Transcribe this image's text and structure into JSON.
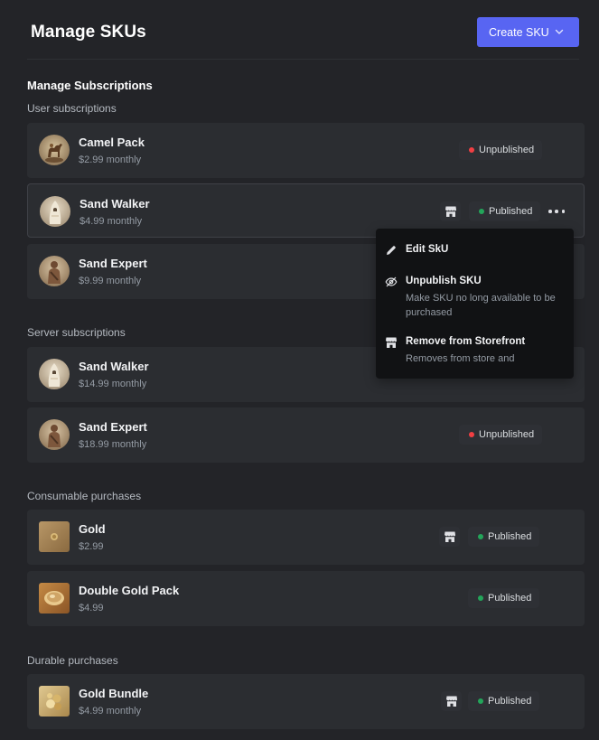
{
  "header": {
    "title": "Manage SKUs",
    "create_label": "Create SKU"
  },
  "section_title": "Manage Subscriptions",
  "groups": {
    "user": "User subscriptions",
    "server": "Server subscriptions",
    "consumable": "Consumable purchases",
    "durable": "Durable purchases"
  },
  "rows": [
    {
      "name": "Camel Pack",
      "price": "$2.99 monthly",
      "status": "Unpublished"
    },
    {
      "name": "Sand Walker",
      "price": "$4.99 monthly",
      "status": "Published"
    },
    {
      "name": "Sand Expert",
      "price": "$9.99 monthly",
      "status": ""
    },
    {
      "name": "Sand Walker",
      "price": "$14.99 monthly",
      "status": ""
    },
    {
      "name": "Sand Expert",
      "price": "$18.99 monthly",
      "status": "Unpublished"
    },
    {
      "name": "Gold",
      "price": "$2.99",
      "status": "Published"
    },
    {
      "name": "Double Gold Pack",
      "price": "$4.99",
      "status": "Published"
    },
    {
      "name": "Gold Bundle",
      "price": "$4.99 monthly",
      "status": "Published"
    }
  ],
  "menu": {
    "edit": {
      "label": "Edit SkU"
    },
    "unpublish": {
      "label": "Unpublish SKU",
      "desc": "Make SKU  no long available to be purchased"
    },
    "remove": {
      "label": "Remove from Storefront",
      "desc": "Removes from store and"
    }
  },
  "icons": {
    "status_dot_unpublished": "red-dot",
    "status_dot_published": "green-dot",
    "storefront": "storefront-icon",
    "more": "more-icon",
    "create_dropdown": "chevron-down-icon"
  },
  "colors": {
    "background": "#232428",
    "row": "#2b2d31",
    "accent": "#5865f2",
    "published": "#23a55a",
    "unpublished": "#f23f43",
    "menu": "#111214"
  }
}
